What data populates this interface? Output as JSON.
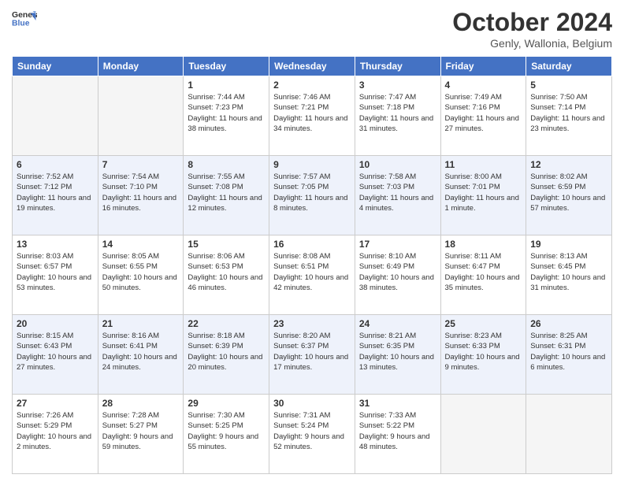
{
  "header": {
    "logo_line1": "General",
    "logo_line2": "Blue",
    "title": "October 2024",
    "subtitle": "Genly, Wallonia, Belgium"
  },
  "days_of_week": [
    "Sunday",
    "Monday",
    "Tuesday",
    "Wednesday",
    "Thursday",
    "Friday",
    "Saturday"
  ],
  "weeks": [
    [
      {
        "day": "",
        "empty": true
      },
      {
        "day": "",
        "empty": true
      },
      {
        "day": "1",
        "sunrise": "7:44 AM",
        "sunset": "7:23 PM",
        "daylight": "11 hours and 38 minutes."
      },
      {
        "day": "2",
        "sunrise": "7:46 AM",
        "sunset": "7:21 PM",
        "daylight": "11 hours and 34 minutes."
      },
      {
        "day": "3",
        "sunrise": "7:47 AM",
        "sunset": "7:18 PM",
        "daylight": "11 hours and 31 minutes."
      },
      {
        "day": "4",
        "sunrise": "7:49 AM",
        "sunset": "7:16 PM",
        "daylight": "11 hours and 27 minutes."
      },
      {
        "day": "5",
        "sunrise": "7:50 AM",
        "sunset": "7:14 PM",
        "daylight": "11 hours and 23 minutes."
      }
    ],
    [
      {
        "day": "6",
        "sunrise": "7:52 AM",
        "sunset": "7:12 PM",
        "daylight": "11 hours and 19 minutes."
      },
      {
        "day": "7",
        "sunrise": "7:54 AM",
        "sunset": "7:10 PM",
        "daylight": "11 hours and 16 minutes."
      },
      {
        "day": "8",
        "sunrise": "7:55 AM",
        "sunset": "7:08 PM",
        "daylight": "11 hours and 12 minutes."
      },
      {
        "day": "9",
        "sunrise": "7:57 AM",
        "sunset": "7:05 PM",
        "daylight": "11 hours and 8 minutes."
      },
      {
        "day": "10",
        "sunrise": "7:58 AM",
        "sunset": "7:03 PM",
        "daylight": "11 hours and 4 minutes."
      },
      {
        "day": "11",
        "sunrise": "8:00 AM",
        "sunset": "7:01 PM",
        "daylight": "11 hours and 1 minute."
      },
      {
        "day": "12",
        "sunrise": "8:02 AM",
        "sunset": "6:59 PM",
        "daylight": "10 hours and 57 minutes."
      }
    ],
    [
      {
        "day": "13",
        "sunrise": "8:03 AM",
        "sunset": "6:57 PM",
        "daylight": "10 hours and 53 minutes."
      },
      {
        "day": "14",
        "sunrise": "8:05 AM",
        "sunset": "6:55 PM",
        "daylight": "10 hours and 50 minutes."
      },
      {
        "day": "15",
        "sunrise": "8:06 AM",
        "sunset": "6:53 PM",
        "daylight": "10 hours and 46 minutes."
      },
      {
        "day": "16",
        "sunrise": "8:08 AM",
        "sunset": "6:51 PM",
        "daylight": "10 hours and 42 minutes."
      },
      {
        "day": "17",
        "sunrise": "8:10 AM",
        "sunset": "6:49 PM",
        "daylight": "10 hours and 38 minutes."
      },
      {
        "day": "18",
        "sunrise": "8:11 AM",
        "sunset": "6:47 PM",
        "daylight": "10 hours and 35 minutes."
      },
      {
        "day": "19",
        "sunrise": "8:13 AM",
        "sunset": "6:45 PM",
        "daylight": "10 hours and 31 minutes."
      }
    ],
    [
      {
        "day": "20",
        "sunrise": "8:15 AM",
        "sunset": "6:43 PM",
        "daylight": "10 hours and 27 minutes."
      },
      {
        "day": "21",
        "sunrise": "8:16 AM",
        "sunset": "6:41 PM",
        "daylight": "10 hours and 24 minutes."
      },
      {
        "day": "22",
        "sunrise": "8:18 AM",
        "sunset": "6:39 PM",
        "daylight": "10 hours and 20 minutes."
      },
      {
        "day": "23",
        "sunrise": "8:20 AM",
        "sunset": "6:37 PM",
        "daylight": "10 hours and 17 minutes."
      },
      {
        "day": "24",
        "sunrise": "8:21 AM",
        "sunset": "6:35 PM",
        "daylight": "10 hours and 13 minutes."
      },
      {
        "day": "25",
        "sunrise": "8:23 AM",
        "sunset": "6:33 PM",
        "daylight": "10 hours and 9 minutes."
      },
      {
        "day": "26",
        "sunrise": "8:25 AM",
        "sunset": "6:31 PM",
        "daylight": "10 hours and 6 minutes."
      }
    ],
    [
      {
        "day": "27",
        "sunrise": "7:26 AM",
        "sunset": "5:29 PM",
        "daylight": "10 hours and 2 minutes."
      },
      {
        "day": "28",
        "sunrise": "7:28 AM",
        "sunset": "5:27 PM",
        "daylight": "9 hours and 59 minutes."
      },
      {
        "day": "29",
        "sunrise": "7:30 AM",
        "sunset": "5:25 PM",
        "daylight": "9 hours and 55 minutes."
      },
      {
        "day": "30",
        "sunrise": "7:31 AM",
        "sunset": "5:24 PM",
        "daylight": "9 hours and 52 minutes."
      },
      {
        "day": "31",
        "sunrise": "7:33 AM",
        "sunset": "5:22 PM",
        "daylight": "9 hours and 48 minutes."
      },
      {
        "day": "",
        "empty": true
      },
      {
        "day": "",
        "empty": true
      }
    ]
  ],
  "labels": {
    "sunrise": "Sunrise:",
    "sunset": "Sunset:",
    "daylight": "Daylight:"
  }
}
